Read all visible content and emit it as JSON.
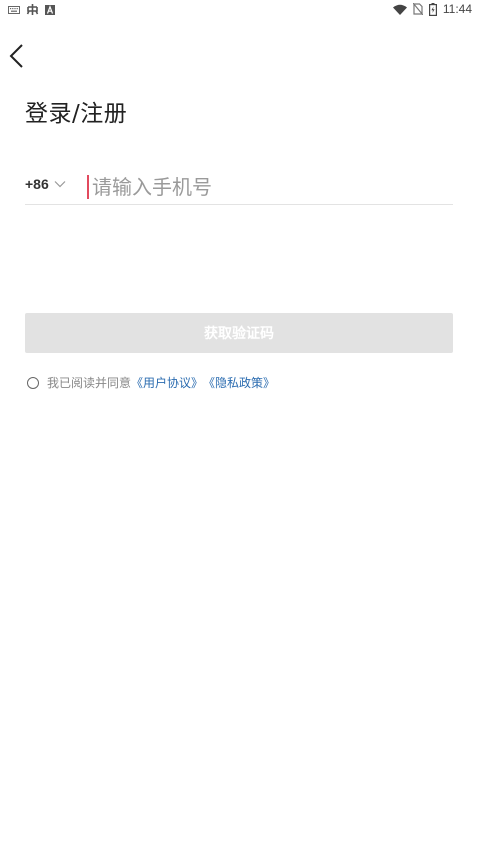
{
  "status_bar": {
    "time": "11:44",
    "left_icons": [
      "keyboard-icon",
      "bug-icon",
      "font-a-icon"
    ],
    "right_icons": [
      "wifi-icon",
      "no-sim-icon",
      "battery-charging-icon"
    ]
  },
  "page": {
    "title": "登录/注册"
  },
  "phone_input": {
    "country_code": "+86",
    "placeholder": "请输入手机号",
    "value": ""
  },
  "buttons": {
    "get_code": "获取验证码"
  },
  "agreement": {
    "prefix": "我已阅读并同意",
    "user_agreement": "《用户协议》",
    "privacy_policy": "《隐私政策》"
  },
  "colors": {
    "cursor": "#e24a5e",
    "button_disabled_bg": "#e2e2e2",
    "link": "#2b6cb0"
  }
}
